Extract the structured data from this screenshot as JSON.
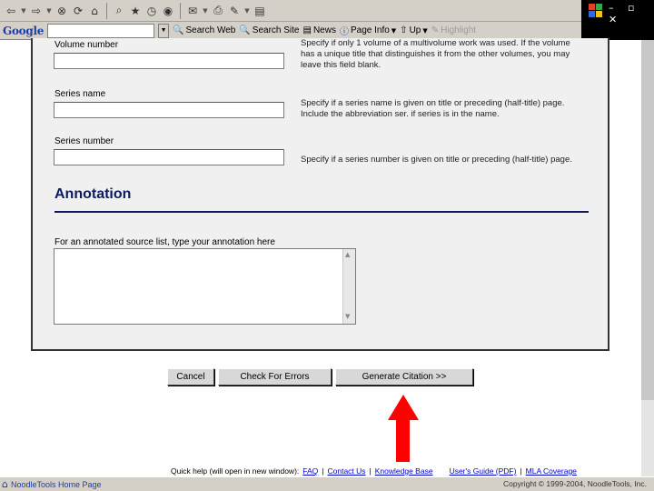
{
  "toolbar": {
    "icons": [
      "back-arrow-icon",
      "forward-arrow-icon",
      "stop-icon",
      "refresh-icon",
      "home-icon",
      "search-icon",
      "favorites-icon",
      "history-icon",
      "mail-icon",
      "print-icon",
      "edit-icon",
      "discuss-icon"
    ]
  },
  "google_bar": {
    "logo": "Google",
    "search_value": "",
    "search_web": "Search Web",
    "search_site": "Search Site",
    "news": "News",
    "page_info": "Page Info",
    "up": "Up",
    "highlight": "Highlight"
  },
  "window": {
    "buttons": "–  ▫  ✕"
  },
  "form": {
    "volume_label": "Volume number",
    "volume_help": "Specify if only 1 volume of a multivolume work was used. If the volume has a unique title that distinguishes it from the other volumes, you may leave this field blank.",
    "series_name_label": "Series name",
    "series_name_help": "Specify if a series name is given on title or preceding (half-title) page. Include the abbreviation ser. if series is in the name.",
    "series_number_label": "Series number",
    "series_number_help": "Specify if a series number is given on title or preceding (half-title) page.",
    "annotation_heading": "Annotation",
    "annotation_label": "For an annotated source list, type your annotation here",
    "annotation_value": ""
  },
  "buttons": {
    "cancel": "Cancel",
    "check": "Check For Errors",
    "generate": "Generate Citation >>"
  },
  "quick_help": {
    "prefix": "Quick help (will open in new window):",
    "links": [
      "FAQ",
      "Contact Us",
      "Knowledge Base",
      "User's Guide (PDF)",
      "MLA Coverage"
    ],
    "separator": "|"
  },
  "status": {
    "home": "NoodleTools Home Page",
    "copyright": "Copyright © 1999-2004, NoodleTools, Inc."
  },
  "colors": {
    "annotation_heading": "#0d1b5e",
    "arrow": "#ff0000",
    "link": "#0000cc"
  }
}
